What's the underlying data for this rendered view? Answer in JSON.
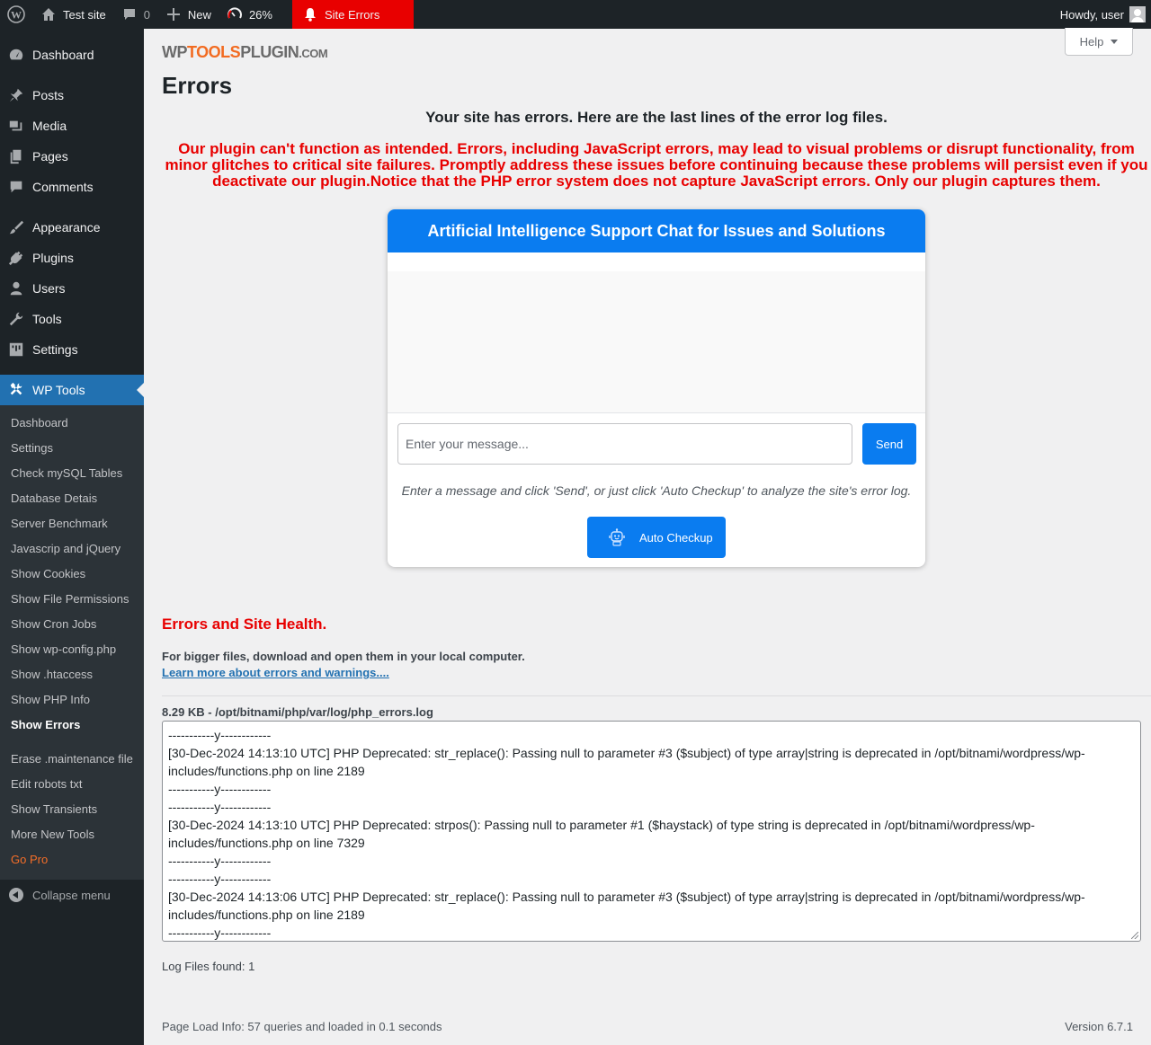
{
  "adminbar": {
    "site_name": "Test site",
    "comments_count": "0",
    "new_label": "New",
    "perf_percent": "26%",
    "site_errors_label": "Site Errors",
    "howdy": "Howdy, user"
  },
  "sidebar": {
    "items": [
      {
        "label": "Dashboard",
        "icon": "dashboard-icon"
      },
      {
        "label": "Posts",
        "icon": "pin-icon"
      },
      {
        "label": "Media",
        "icon": "media-icon"
      },
      {
        "label": "Pages",
        "icon": "pages-icon"
      },
      {
        "label": "Comments",
        "icon": "comments-icon"
      },
      {
        "label": "Appearance",
        "icon": "brush-icon"
      },
      {
        "label": "Plugins",
        "icon": "plug-icon"
      },
      {
        "label": "Users",
        "icon": "user-icon"
      },
      {
        "label": "Tools",
        "icon": "wrench-icon"
      },
      {
        "label": "Settings",
        "icon": "settings-icon"
      },
      {
        "label": "WP Tools",
        "icon": "hammer-wrench-icon"
      }
    ],
    "submenu": [
      "Dashboard",
      "Settings",
      "Check mySQL Tables",
      "Database Detais",
      "Server Benchmark",
      "Javascrip and jQuery",
      "Show Cookies",
      "Show File Permissions",
      "Show Cron Jobs",
      "Show wp-config.php",
      "Show .htaccess",
      "Show PHP Info",
      "Show Errors",
      "Erase .maintenance file",
      "Edit robots txt",
      "Show Transients",
      "More New Tools",
      "Go Pro"
    ],
    "collapse_label": "Collapse menu"
  },
  "header": {
    "logo_part1": "WP",
    "logo_part2": "TOOLS",
    "logo_part3": "PLUGIN",
    "logo_part4": ".COM",
    "help_label": "Help",
    "page_title": "Errors"
  },
  "notices": {
    "main": "Your site has errors. Here are the last lines of the error log files.",
    "warning": "Our plugin can't function as intended. Errors, including JavaScript errors, may lead to visual problems or disrupt functionality, from minor glitches to critical site failures. Promptly address these issues before continuing because these problems will persist even if you deactivate our plugin.Notice that the PHP error system does not capture JavaScript errors. Only our plugin captures them."
  },
  "chat": {
    "title": "Artificial Intelligence Support Chat for Issues and Solutions",
    "placeholder": "Enter your message...",
    "send_label": "Send",
    "hint": "Enter a message and click 'Send', or just click 'Auto Checkup' to analyze the site's error log.",
    "auto_label": "Auto Checkup"
  },
  "errors_section": {
    "title": "Errors and Site Health.",
    "bigfiles": "For bigger files, download and open them in your local computer.",
    "learn_more": "Learn more about errors and warnings....",
    "log_path": "8.29 KB - /opt/bitnami/php/var/log/php_errors.log",
    "log_lines": [
      "-----------y------------",
      "[30-Dec-2024 14:13:10 UTC] PHP Deprecated:  str_replace(): Passing null to parameter #3 ($subject) of type array|string is deprecated in /opt/bitnami/wordpress/wp-includes/functions.php on line 2189",
      "-----------y------------",
      "-----------y------------",
      "[30-Dec-2024 14:13:10 UTC] PHP Deprecated:  strpos(): Passing null to parameter #1 ($haystack) of type string is deprecated in /opt/bitnami/wordpress/wp-includes/functions.php on line 7329",
      "-----------y------------",
      "-----------y------------",
      "[30-Dec-2024 14:13:06 UTC] PHP Deprecated:  str_replace(): Passing null to parameter #3 ($subject) of type array|string is deprecated in /opt/bitnami/wordpress/wp-includes/functions.php on line 2189",
      "-----------y------------"
    ],
    "log_count": "Log Files found: 1"
  },
  "footer": {
    "page_load": "Page Load Info: 57 queries and loaded in 0.1 seconds",
    "version": "Version 6.7.1"
  },
  "colors": {
    "admin_bg": "#1d2327",
    "accent": "#2271b1",
    "error_red": "#e80000",
    "chat_blue": "#0a7cf0",
    "go_pro": "#f56e28"
  }
}
